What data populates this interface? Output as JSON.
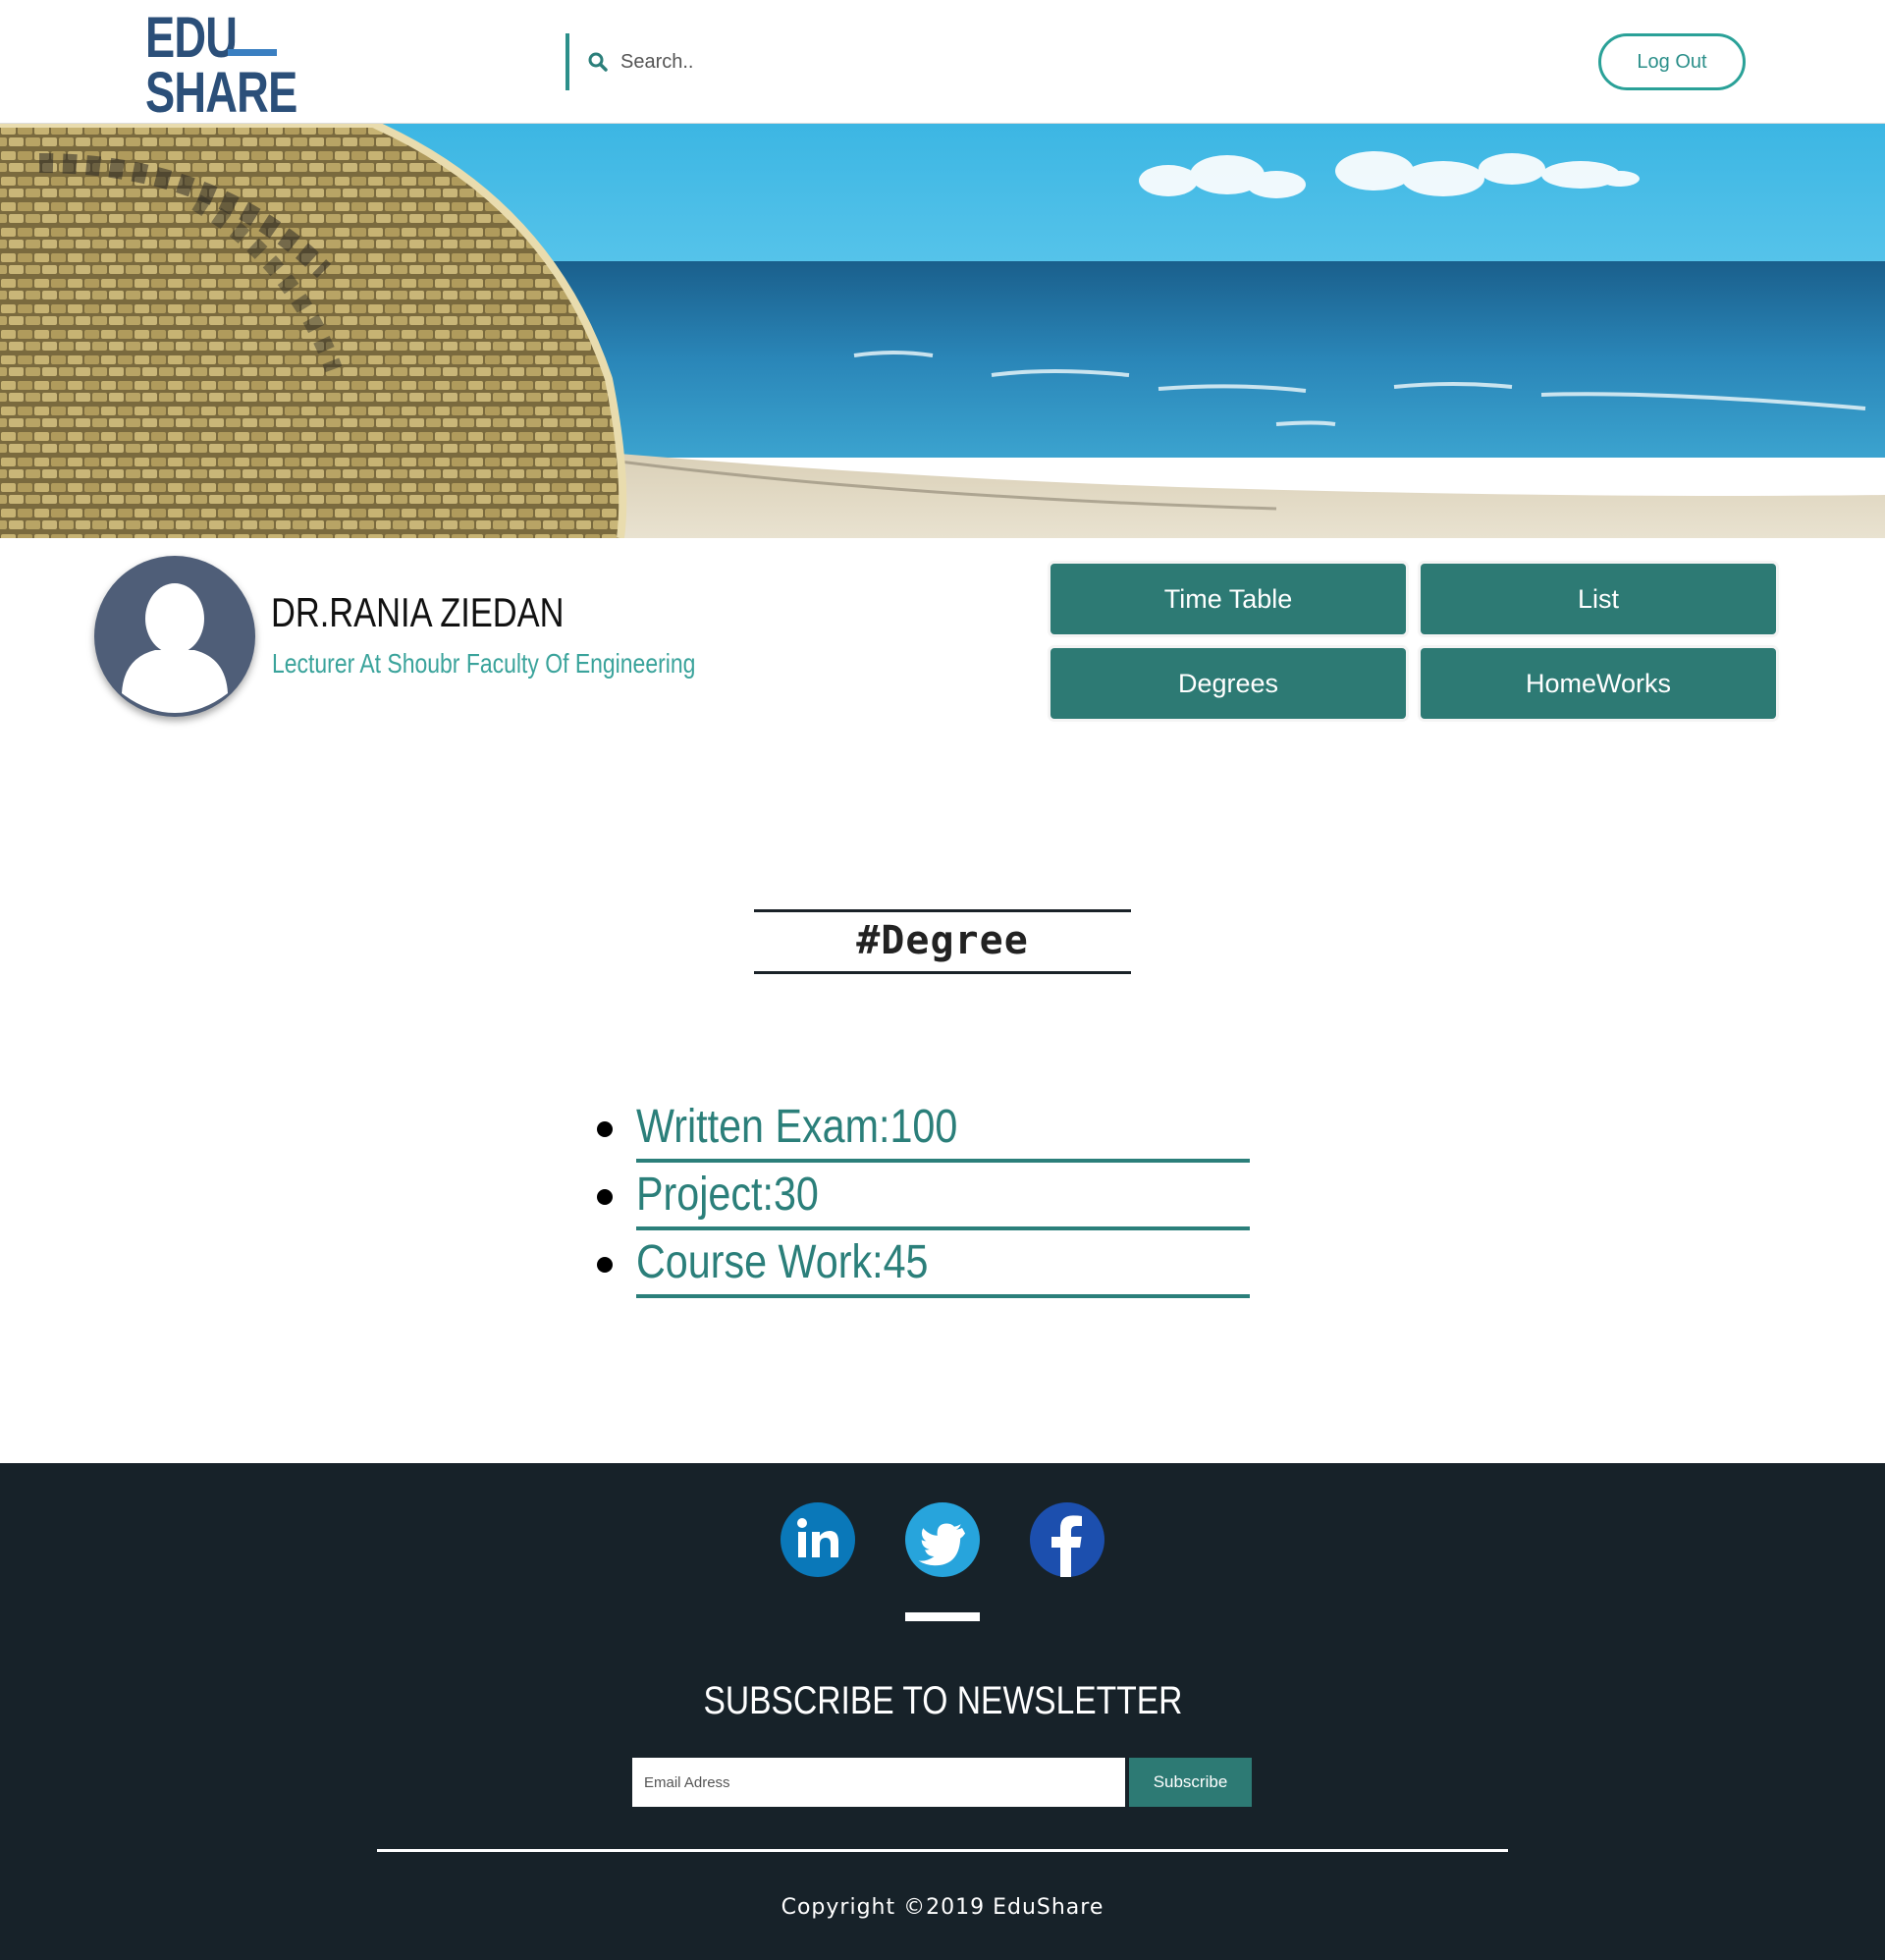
{
  "header": {
    "logo_top": "EDU",
    "logo_bottom": "SHARE",
    "search_placeholder": "Search..",
    "logout_label": "Log Out"
  },
  "profile": {
    "name": "DR.RANIA ZIEDAN",
    "title": "Lecturer At Shoubr Faculty Of Engineering"
  },
  "nav_buttons": [
    {
      "label": "Time Table"
    },
    {
      "label": "List"
    },
    {
      "label": "Degrees"
    },
    {
      "label": "HomeWorks"
    }
  ],
  "degree": {
    "heading": "#Degree",
    "items": [
      {
        "text": "Written Exam:100"
      },
      {
        "text": "Project:30"
      },
      {
        "text": "Course Work:45"
      }
    ]
  },
  "footer": {
    "social": [
      {
        "icon": "linkedin-icon"
      },
      {
        "icon": "twitter-icon"
      },
      {
        "icon": "facebook-icon"
      }
    ],
    "newsletter_title": "SUBSCRIBE TO NEWSLETTER",
    "email_placeholder": "Email Adress",
    "subscribe_label": "Subscribe",
    "copyright": "Copyright ©2019 EduShare"
  },
  "colors": {
    "accent": "#2d7a74",
    "logo": "#2b4f79",
    "footer_bg": "#172229"
  }
}
